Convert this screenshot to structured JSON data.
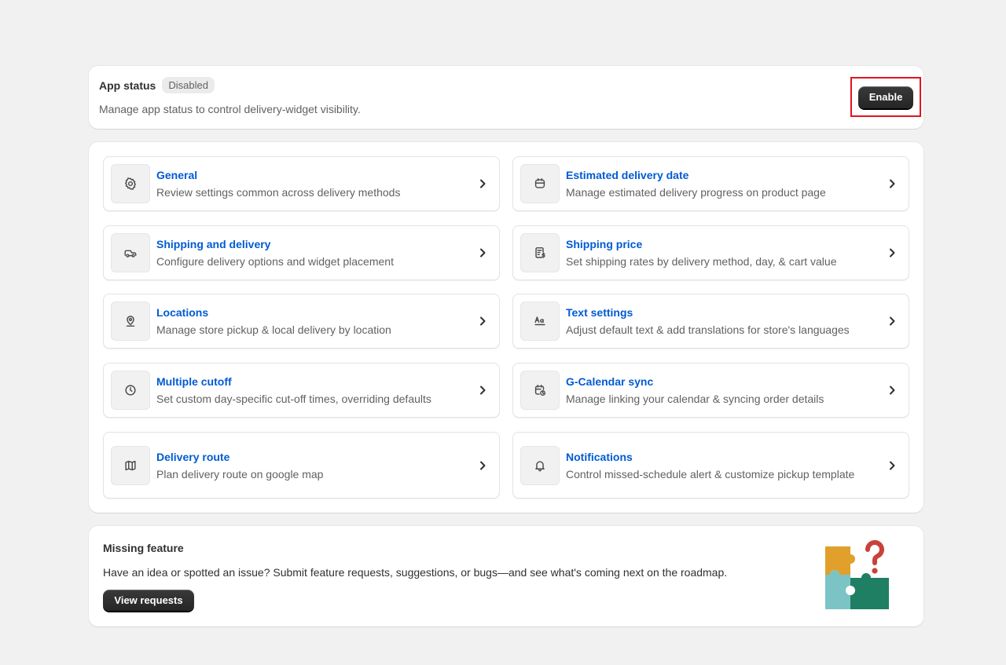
{
  "app_status": {
    "title": "App status",
    "badge": "Disabled",
    "description": "Manage app status to control delivery-widget visibility.",
    "enable_label": "Enable"
  },
  "settings": {
    "items": [
      {
        "title": "General",
        "desc": "Review settings common across delivery methods",
        "icon": "gear-icon"
      },
      {
        "title": "Estimated delivery date",
        "desc": "Manage estimated delivery progress on product page",
        "icon": "calendar-icon"
      },
      {
        "title": "Shipping and delivery",
        "desc": "Configure delivery options and widget placement",
        "icon": "truck-icon"
      },
      {
        "title": "Shipping price",
        "desc": "Set shipping rates by delivery method, day, & cart value",
        "icon": "receipt-dollar-icon"
      },
      {
        "title": "Locations",
        "desc": "Manage store pickup & local delivery by location",
        "icon": "location-pin-icon"
      },
      {
        "title": "Text settings",
        "desc": "Adjust default text & add translations for store's languages",
        "icon": "text-icon"
      },
      {
        "title": "Multiple cutoff",
        "desc": "Set custom day-specific cut-off times, overriding defaults",
        "icon": "clock-icon"
      },
      {
        "title": "G-Calendar sync",
        "desc": "Manage linking your calendar & syncing order details",
        "icon": "calendar-sync-icon"
      },
      {
        "title": "Delivery route",
        "desc": "Plan delivery route on google map",
        "icon": "map-icon"
      },
      {
        "title": "Notifications",
        "desc": "Control missed-schedule alert & customize pickup template",
        "icon": "bell-icon"
      }
    ]
  },
  "missing_feature": {
    "title": "Missing feature",
    "description": "Have an idea or spotted an issue? Submit feature requests, suggestions, or bugs—and see what's coming next on the roadmap.",
    "button_label": "View requests",
    "illustration": "puzzle-question-illustration"
  },
  "colors": {
    "link": "#005bd3",
    "highlight_border": "#e0141e",
    "button_dark": "#303030"
  }
}
